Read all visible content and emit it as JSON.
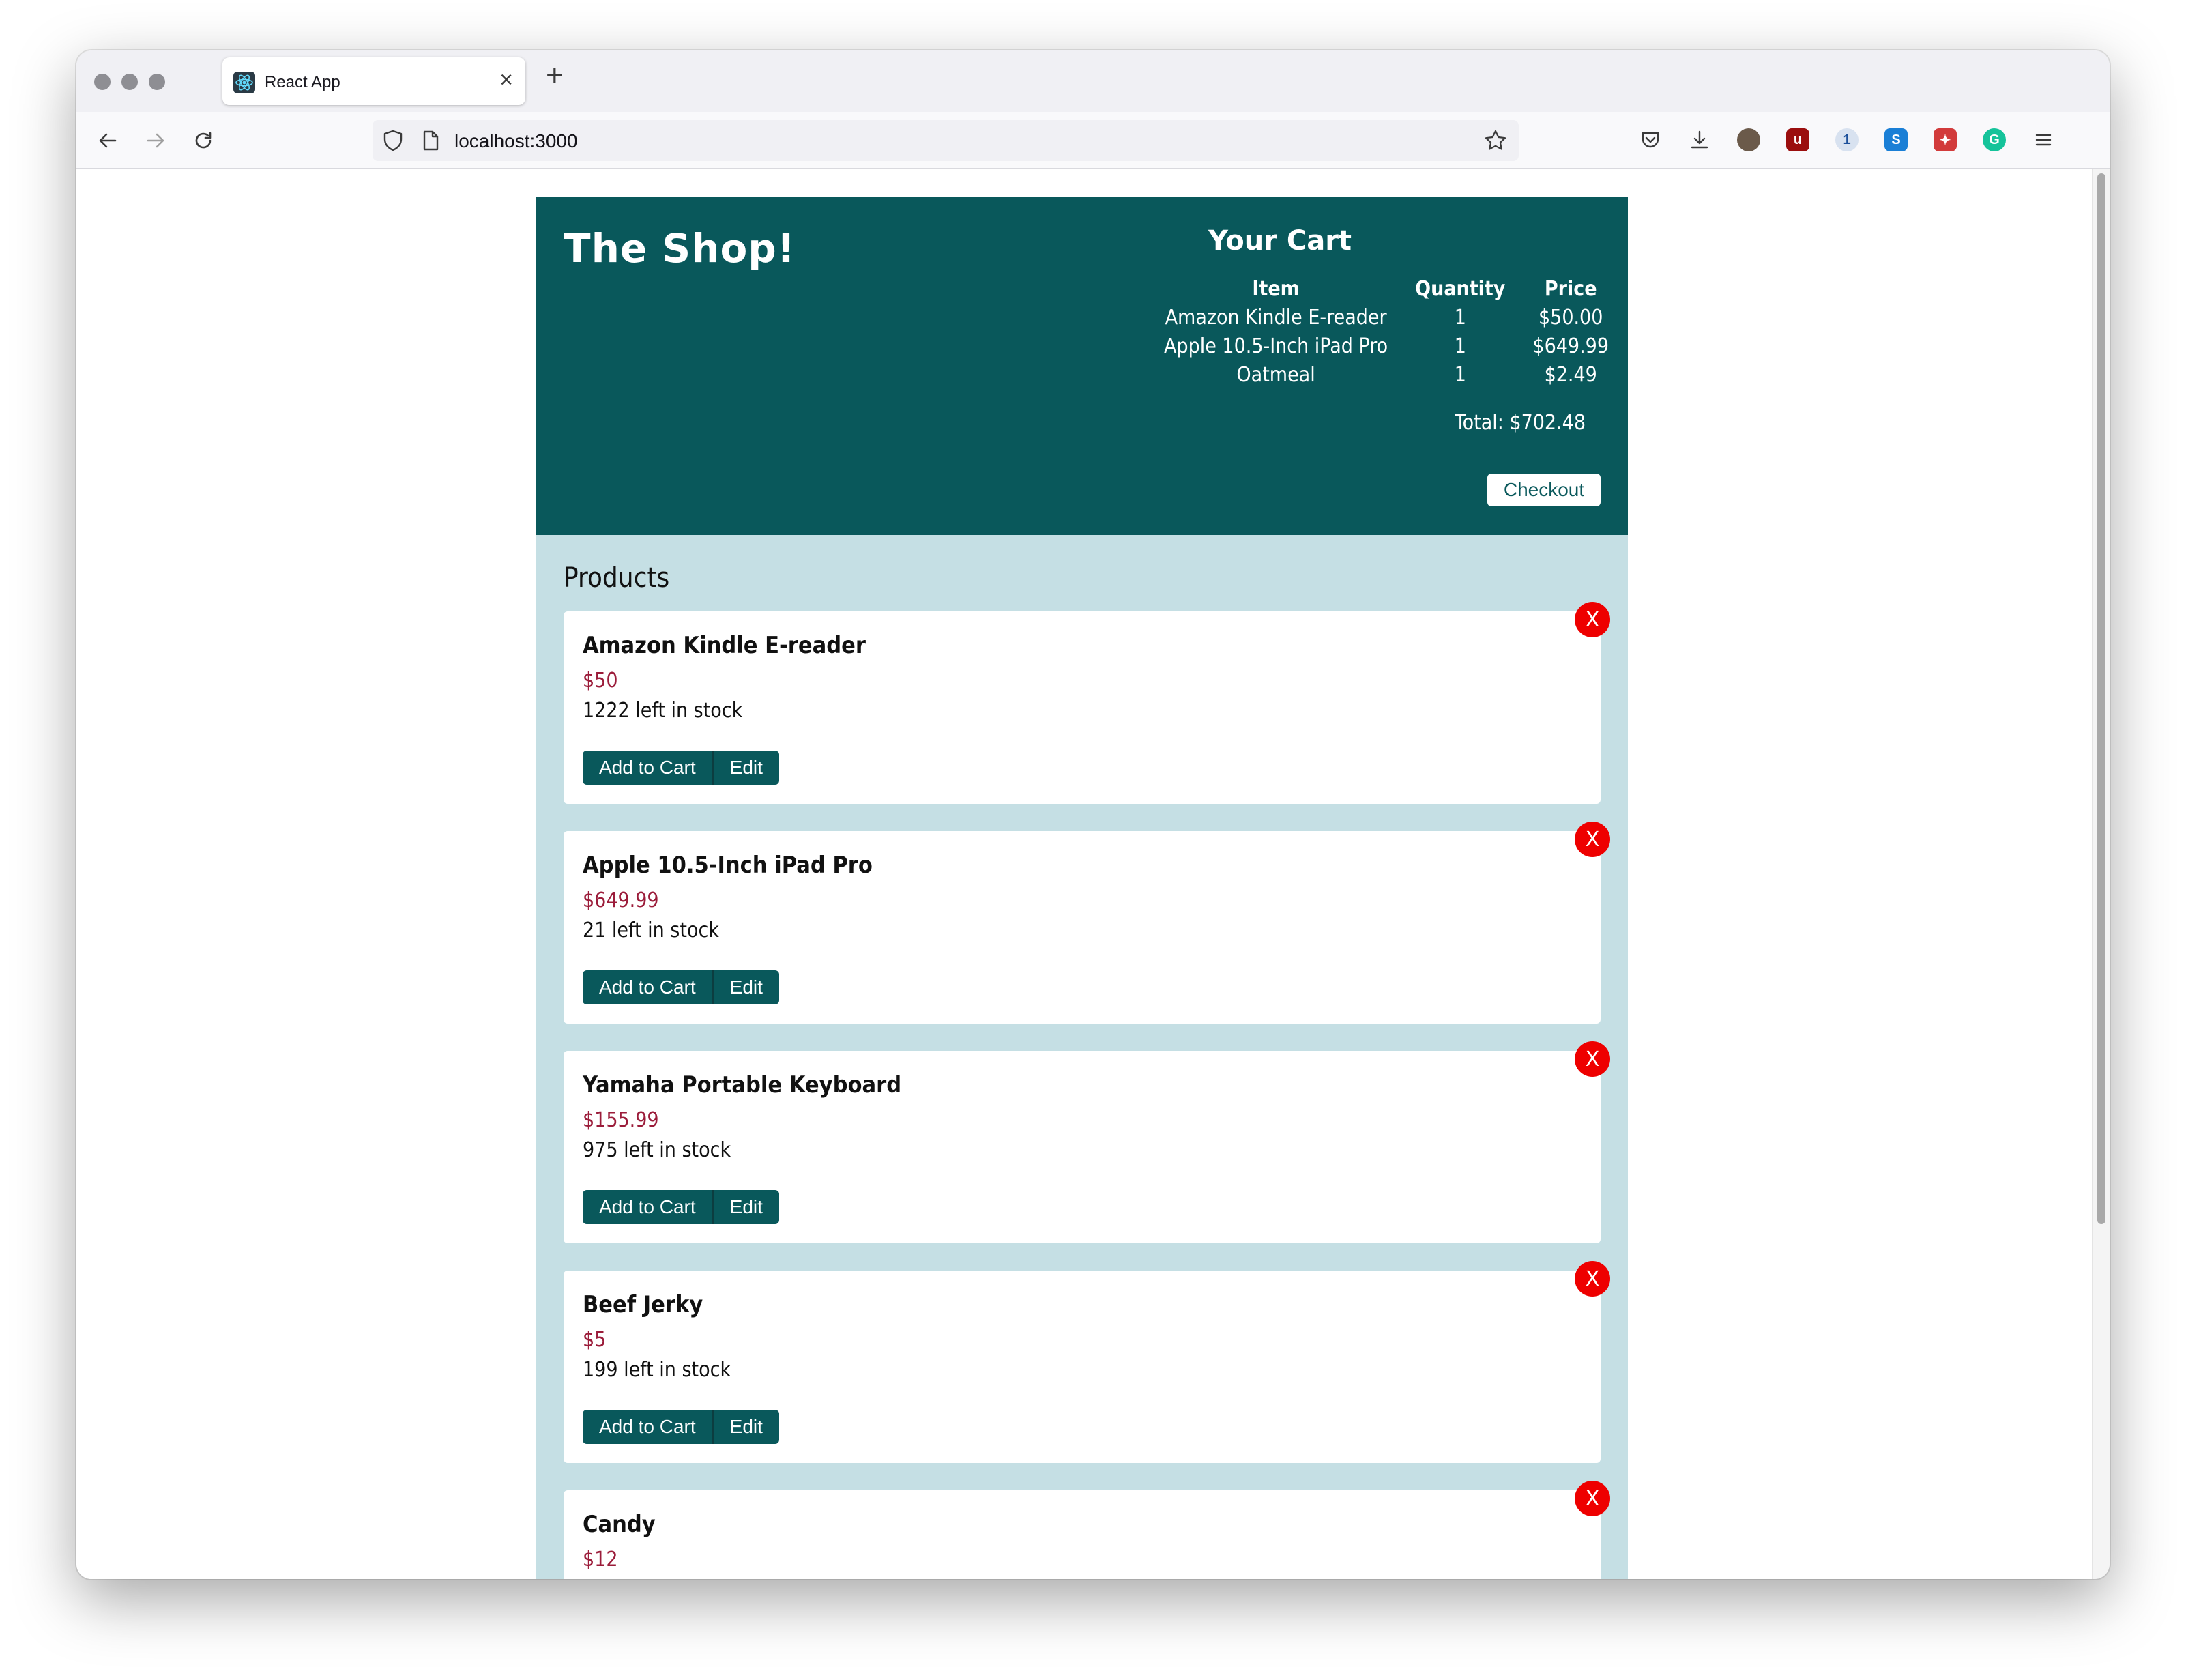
{
  "browser": {
    "tab_title": "React App",
    "tab_close": "×",
    "new_tab": "+",
    "url": "localhost:3000",
    "icons": [
      "back-arrow-icon",
      "forward-arrow-icon",
      "reload-icon",
      "shield-icon",
      "page-icon",
      "star-icon",
      "pocket-icon",
      "download-icon",
      "avatar-icon",
      "ublock-icon",
      "extension-icon",
      "s-extension-icon",
      "puzzle-extension-icon",
      "grammarly-icon",
      "menu-icon"
    ]
  },
  "header": {
    "logo": "The Shop!",
    "cart": {
      "title": "Your Cart",
      "columns": [
        "Item",
        "Quantity",
        "Price"
      ],
      "rows": [
        {
          "item": "Amazon Kindle E-reader",
          "quantity": "1",
          "price": "$50.00"
        },
        {
          "item": "Apple 10.5-Inch iPad Pro",
          "quantity": "1",
          "price": "$649.99"
        },
        {
          "item": "Oatmeal",
          "quantity": "1",
          "price": "$2.49"
        }
      ],
      "total": "Total: $702.48",
      "checkout_label": "Checkout"
    }
  },
  "products": {
    "title": "Products",
    "add_label": "Add to Cart",
    "edit_label": "Edit",
    "delete_label": "X",
    "items": [
      {
        "name": "Amazon Kindle E-reader",
        "price": "$50",
        "stock": "1222 left in stock"
      },
      {
        "name": "Apple 10.5-Inch iPad Pro",
        "price": "$649.99",
        "stock": "21 left in stock"
      },
      {
        "name": "Yamaha Portable Keyboard",
        "price": "$155.99",
        "stock": "975 left in stock"
      },
      {
        "name": "Beef Jerky",
        "price": "$5",
        "stock": "199 left in stock"
      },
      {
        "name": "Candy",
        "price": "$12",
        "stock": ""
      }
    ]
  },
  "colors": {
    "header_bg": "#09585b",
    "products_bg": "#c5dfe4",
    "price": "#9b1c3a",
    "delete": "#ee0000"
  }
}
